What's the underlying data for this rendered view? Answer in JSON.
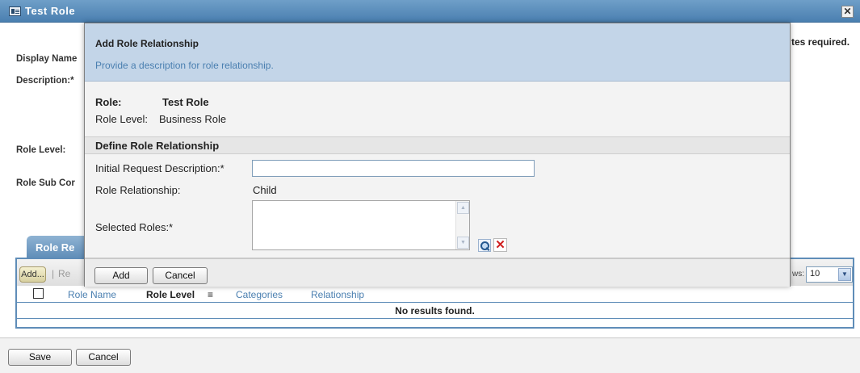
{
  "window": {
    "title": "Test Role",
    "close_glyph": "✕",
    "required_note": "tes required."
  },
  "form": {
    "display_name_label": "Display Name",
    "description_label": "Description:*",
    "role_level_label": "Role Level:",
    "role_sub_label": "Role Sub Cor"
  },
  "role_relationships_panel": {
    "tab_label": "Role Re",
    "add_button": "Add...",
    "separator": "|",
    "toolbar_partial": "Re",
    "rows_label": "ws:",
    "rows_value": "10",
    "columns": [
      "Role Name",
      "Role Level",
      "Categories",
      "Relationship"
    ],
    "sort_indicator": "≡",
    "empty_message": "No results found."
  },
  "footer": {
    "save_button": "Save",
    "cancel_button": "Cancel"
  },
  "dialog": {
    "title": "Add Role Relationship",
    "subtitle": "Provide a description for role relationship.",
    "role_label": "Role:",
    "role_value": "Test Role",
    "role_level_label": "Role Level:",
    "role_level_value": "Business Role",
    "section_title": "Define Role Relationship",
    "initial_request_label": "Initial Request Description:*",
    "initial_request_value": "",
    "relationship_label": "Role Relationship:",
    "relationship_value": "Child",
    "selected_roles_label": "Selected Roles:*",
    "selected_roles": [],
    "add_button": "Add",
    "cancel_button": "Cancel"
  },
  "icons": {
    "window_icon": "role-window-icon",
    "lookup_icon": "magnifier-icon",
    "remove_icon": "red-x-icon"
  },
  "colors": {
    "titlebar": "#4a7fb0",
    "dialog_header": "#c3d5e8",
    "link_blue": "#4a7fb0",
    "remove_red": "#d01f1f"
  }
}
